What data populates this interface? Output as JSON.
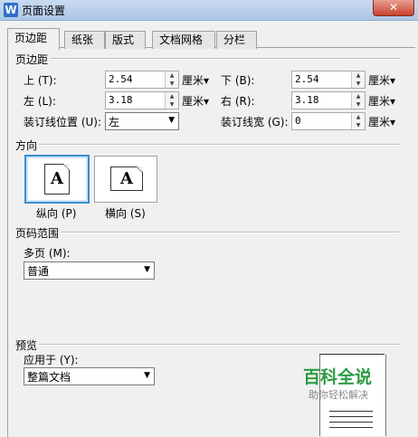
{
  "window": {
    "title": "页面设置",
    "app_icon_letter": "W",
    "close_label": "✕"
  },
  "tabs": [
    {
      "label": "页边距",
      "active": true
    },
    {
      "label": "纸张",
      "active": false
    },
    {
      "label": "版式",
      "active": false
    },
    {
      "label": "文档网格",
      "active": false
    },
    {
      "label": "分栏",
      "active": false
    }
  ],
  "margins": {
    "group_title": "页边距",
    "top": {
      "label": "上 (T):",
      "value": "2.54",
      "unit": "厘米▾"
    },
    "bottom": {
      "label": "下 (B):",
      "value": "2.54",
      "unit": "厘米▾"
    },
    "left": {
      "label": "左 (L):",
      "value": "3.18",
      "unit": "厘米▾"
    },
    "right": {
      "label": "右 (R):",
      "value": "3.18",
      "unit": "厘米▾"
    },
    "gutter_position": {
      "label": "装订线位置 (U):",
      "value": "左"
    },
    "gutter": {
      "label": "装订线宽 (G):",
      "value": "0",
      "unit": "厘米▾"
    }
  },
  "orientation": {
    "group_title": "方向",
    "portrait": {
      "label": "纵向 (P)",
      "glyph": "A",
      "selected": true
    },
    "landscape": {
      "label": "横向 (S)",
      "glyph": "A",
      "selected": false
    }
  },
  "page_range": {
    "group_title": "页码范围",
    "multiple_pages_label": "多页 (M):",
    "multiple_pages_value": "普通"
  },
  "preview": {
    "group_title": "预览",
    "apply_to_label": "应用于 (Y):",
    "apply_to_value": "整篇文档"
  },
  "watermark": {
    "line1": "百科全说",
    "line2": "助你轻松解决"
  },
  "icons": {
    "spin_up": "▲",
    "spin_down": "▼",
    "dropdown_caret": "▼"
  }
}
